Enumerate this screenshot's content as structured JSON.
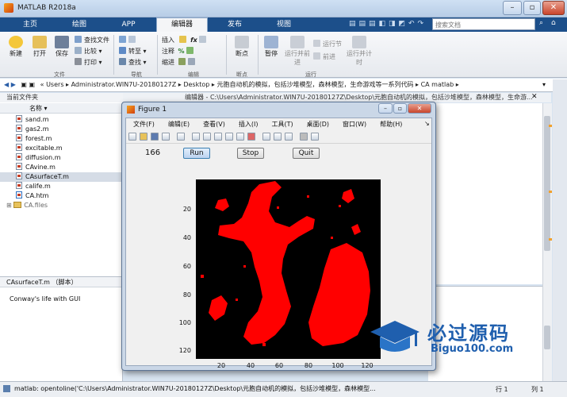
{
  "app": {
    "title": "MATLAB R2018a"
  },
  "tabs": [
    "主页",
    "绘图",
    "APP",
    "编辑器",
    "发布",
    "视图"
  ],
  "search_placeholder": "搜索文档",
  "ribbon": {
    "file": {
      "new": "新建",
      "open": "打开",
      "save": "保存",
      "find_files": "查找文件",
      "compare": "比较",
      "print": "打印",
      "group": "文件"
    },
    "nav": {
      "goto": "转至",
      "find": "查找",
      "group": "导航"
    },
    "edit": {
      "insert": "插入",
      "comment": "注释",
      "indent": "缩进",
      "group": "编辑"
    },
    "breakpoints": {
      "breakpoints": "断点",
      "group": "断点"
    },
    "run": {
      "pause": "暂停",
      "run_advance": "运行并前进",
      "run_section": "运行节",
      "advance": "前进",
      "run_time": "运行并计时",
      "group": "运行"
    }
  },
  "path": {
    "parts": [
      "Users",
      "Administrator.WIN7U-20180127Z",
      "Desktop",
      "元胞自动机的模拟，包括沙堆模型，森林模型，生命游戏等一系列代码",
      "CA matlab"
    ]
  },
  "current_folder": {
    "header": "当前文件夹",
    "name_col": "名称",
    "files": [
      "sand.m",
      "gas2.m",
      "forest.m",
      "excitable.m",
      "diffusion.m",
      "CAvine.m",
      "CAsurfaceT.m",
      "calife.m",
      "CA.htm",
      "CA.files"
    ],
    "selected": "CAsurfaceT.m"
  },
  "details": {
    "header": "CAsurfaceT.m （脚本）",
    "text": "Conway's life with GUI"
  },
  "editor": {
    "header": "编辑器 - C:\\Users\\Administrator.WIN7U-20180127Z\\Desktop\\元胞自动机的模拟，包括沙堆模型，森林模型，生命游..."
  },
  "status": {
    "text": "matlab: opentoline('C:\\Users\\Administrator.WIN7U-20180127Z\\Desktop\\元胞自动机的模拟，包括沙堆模型，森林模型...",
    "row_label": "行",
    "row": "1",
    "col_label": "列",
    "col": "1"
  },
  "figure": {
    "title": "Figure 1",
    "menu": [
      "文件(F)",
      "编辑(E)",
      "查看(V)",
      "插入(I)",
      "工具(T)",
      "桌面(D)",
      "窗口(W)",
      "帮助(H)"
    ],
    "counter": "166",
    "run": "Run",
    "stop": "Stop",
    "quit": "Quit",
    "yticks": [
      "20",
      "40",
      "60",
      "80",
      "100",
      "120"
    ],
    "xticks": [
      "20",
      "40",
      "60",
      "80",
      "100",
      "120"
    ]
  },
  "colors": {
    "cell": "#ff0000",
    "bg": "#000000",
    "accent": "#1c4f8a"
  },
  "watermark": {
    "cn": "必过源码",
    "en": "Biguo100.com"
  }
}
